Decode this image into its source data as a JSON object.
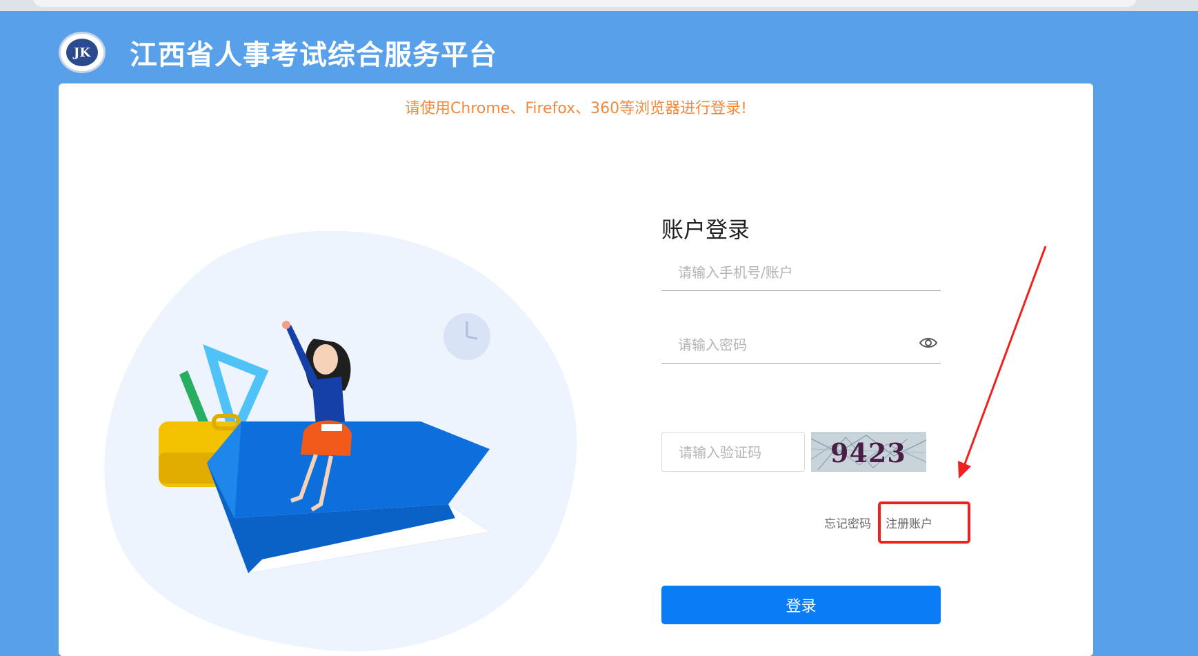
{
  "header": {
    "logo_text": "JK",
    "site_title": "江西省人事考试综合服务平台"
  },
  "notice": {
    "browser_tip": "请使用Chrome、Firefox、360等浏览器进行登录!"
  },
  "login": {
    "title": "账户登录",
    "account_placeholder": "请输入手机号/账户",
    "password_placeholder": "请输入密码",
    "captcha_placeholder": "请输入验证码",
    "captcha_code": "9423",
    "forgot_password": "忘记密码",
    "register": "注册账户",
    "login_button": "登录"
  },
  "icons": {
    "password_toggle": "eye-icon",
    "logo": "seal-logo-icon",
    "annotation_arrow": "red-arrow",
    "annotation_box": "red-highlight-box"
  },
  "colors": {
    "page_bg": "#58a1ea",
    "tip": "#f0893b",
    "primary": "#0a7cf5",
    "annotation": "#f02020"
  }
}
